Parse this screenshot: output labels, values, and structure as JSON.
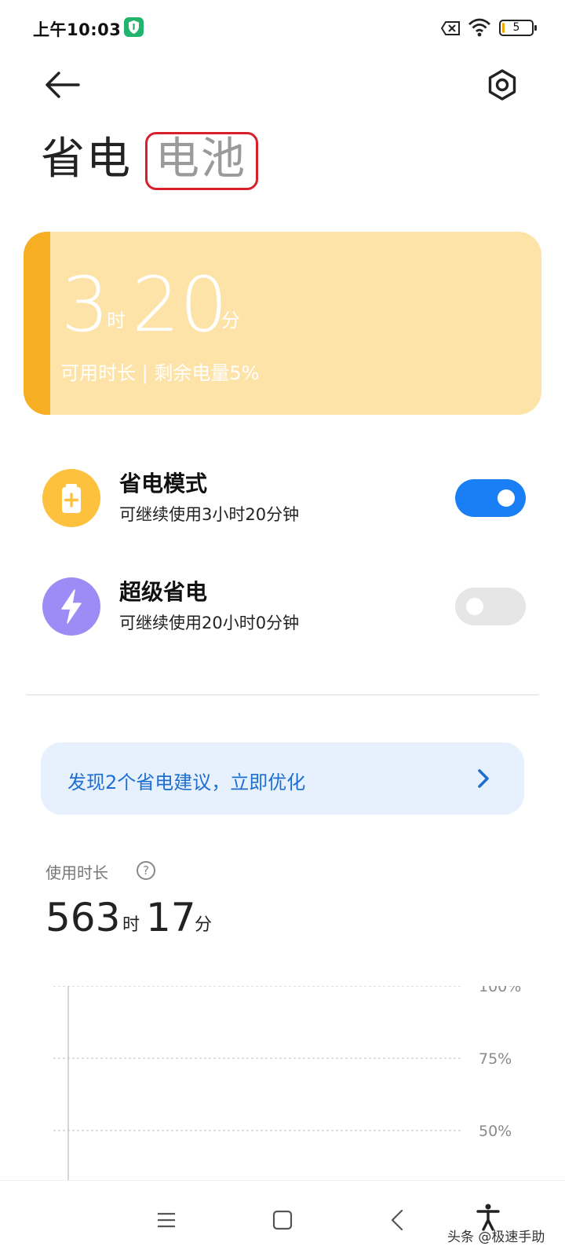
{
  "status_bar": {
    "time": "上午10:03",
    "battery_level": "5",
    "battery_fraction": 0.05
  },
  "header": {
    "title": "省电",
    "title_highlight": "电池"
  },
  "battery_card": {
    "hours": "3",
    "hours_unit": "时",
    "minutes": "20",
    "minutes_unit": "分",
    "info": "可用时长 | 剩余电量5%",
    "strip_color": "#f6ae22",
    "bg_color": "#fde3a8"
  },
  "modes": [
    {
      "title": "省电模式",
      "desc": "可继续使用3小时20分钟",
      "enabled": true,
      "icon": "battery-plus-icon",
      "icon_color": "#fdc13e"
    },
    {
      "title": "超级省电",
      "desc": "可继续使用20小时0分钟",
      "enabled": false,
      "icon": "lightning-icon",
      "icon_color": "#9d8cf5"
    }
  ],
  "suggestion": {
    "text": "发现2个省电建议，立即优化"
  },
  "usage": {
    "label": "使用时长",
    "hours": "563",
    "hours_unit": "时",
    "minutes": "17",
    "minutes_unit": "分"
  },
  "chart_data": {
    "type": "line",
    "y_ticks": [
      "100%",
      "75%",
      "50%"
    ],
    "ylim": [
      50,
      100
    ],
    "grid": true
  },
  "nav": {
    "items": [
      "menu-icon",
      "home-icon",
      "back-icon",
      "accessibility-icon"
    ]
  },
  "watermark": "头条 @极速手助",
  "colors": {
    "accent": "#1a7ff5",
    "toggle_off": "#e6e6e6"
  }
}
